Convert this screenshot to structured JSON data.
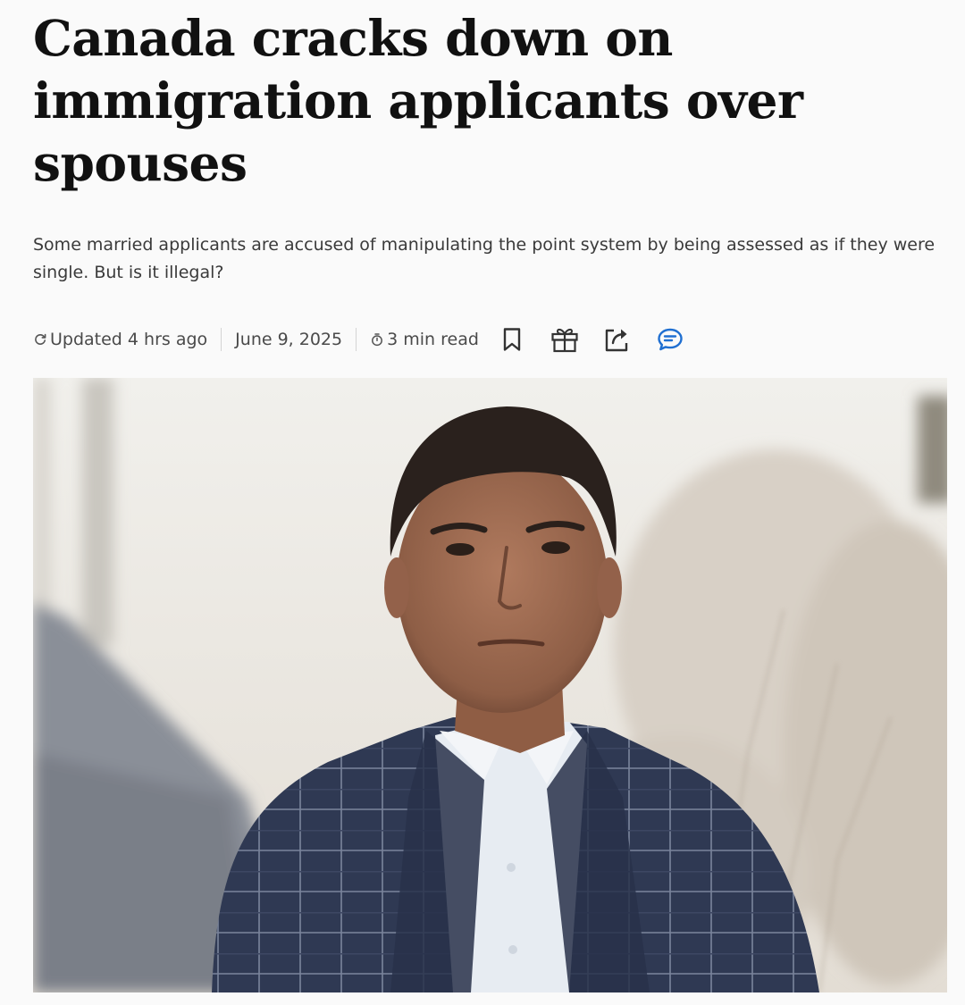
{
  "article": {
    "headline": "Canada cracks down on immigration applicants over spouses",
    "dek": "Some married applicants are accused of manipulating the point system by being assessed as if they were single. But is it illegal?",
    "meta": {
      "updated": "Updated 4 hrs ago",
      "date": "June 9, 2025",
      "read_time": "3 min read"
    },
    "actions": [
      {
        "icon": "bookmark-icon",
        "color": "#333333"
      },
      {
        "icon": "gift-icon",
        "color": "#333333"
      },
      {
        "icon": "share-icon",
        "color": "#333333"
      },
      {
        "icon": "comment-icon",
        "color": "#1f6fd1"
      }
    ],
    "image": {
      "subject": "portrait-photo"
    }
  }
}
